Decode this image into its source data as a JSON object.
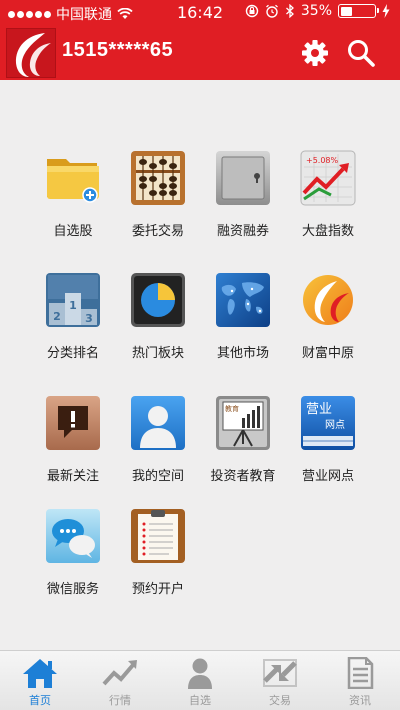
{
  "status_bar": {
    "carrier": "中国联通",
    "time": "16:42",
    "battery": "35%",
    "battery_level": 0.35,
    "signal_bars": 5
  },
  "header": {
    "account": "1515*****65",
    "settings_icon": "gear-icon",
    "search_icon": "search-icon"
  },
  "grid": {
    "items": [
      {
        "label": "自选股",
        "icon": "folder-icon"
      },
      {
        "label": "委托交易",
        "icon": "abacus-icon"
      },
      {
        "label": "融资融券",
        "icon": "safe-icon"
      },
      {
        "label": "大盘指数",
        "icon": "index-chart-icon",
        "icon_text": "+5.08%"
      },
      {
        "label": "分类排名",
        "icon": "podium-icon",
        "icon_numbers": [
          "2",
          "1",
          "3"
        ]
      },
      {
        "label": "热门板块",
        "icon": "pie-chart-icon"
      },
      {
        "label": "其他市场",
        "icon": "world-map-icon"
      },
      {
        "label": "财富中原",
        "icon": "brand-logo-icon"
      },
      {
        "label": "最新关注",
        "icon": "alert-bubble-icon"
      },
      {
        "label": "我的空间",
        "icon": "user-icon"
      },
      {
        "label": "投资者教育",
        "icon": "presentation-board-icon",
        "icon_text": "教育"
      },
      {
        "label": "营业网点",
        "icon": "branch-book-icon",
        "icon_text": "营业",
        "icon_subtext": "网点"
      },
      {
        "label": "微信服务",
        "icon": "chat-bubbles-icon"
      },
      {
        "label": "预约开户",
        "icon": "clipboard-icon"
      }
    ]
  },
  "tabbar": {
    "tabs": [
      {
        "label": "首页",
        "icon": "home-icon",
        "active": true
      },
      {
        "label": "行情",
        "icon": "trend-icon",
        "active": false
      },
      {
        "label": "自选",
        "icon": "person-icon",
        "active": false
      },
      {
        "label": "交易",
        "icon": "exchange-icon",
        "active": false
      },
      {
        "label": "资讯",
        "icon": "document-icon",
        "active": false
      }
    ]
  },
  "colors": {
    "brand_red": "#e01e24",
    "active_tab": "#1d7fd6",
    "inactive_tab": "#9a9a9a"
  }
}
